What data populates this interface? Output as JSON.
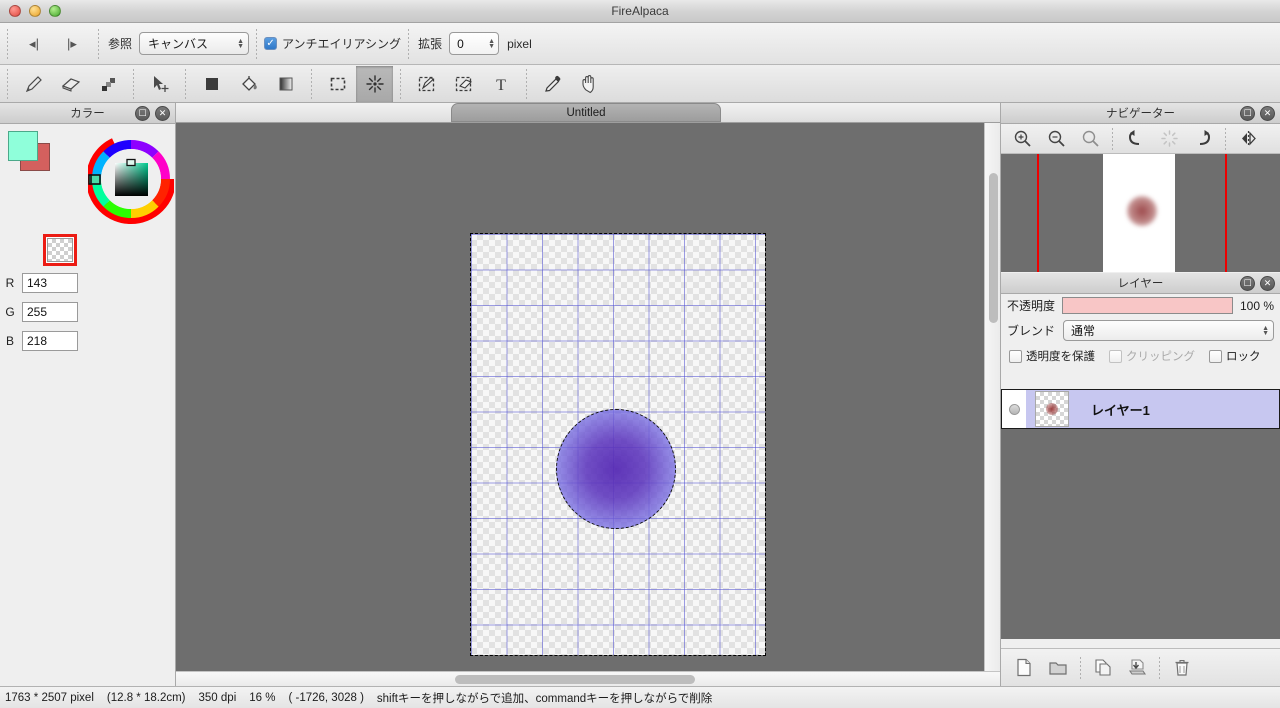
{
  "window": {
    "title": "FireAlpaca",
    "controls": [
      "close",
      "minimize",
      "zoom"
    ]
  },
  "option_bar": {
    "prev_label": "◂|",
    "next_label": "|▸",
    "reference_label": "参照",
    "reference_value": "キャンバス",
    "antialias_label": "アンチエイリアシング",
    "antialias_checked": true,
    "expand_label": "拡張",
    "expand_value": "0",
    "expand_unit": "pixel"
  },
  "tools": [
    {
      "name": "pencil-tool",
      "icon": "pencil",
      "active": false
    },
    {
      "name": "eraser-tool",
      "icon": "eraser",
      "active": false
    },
    {
      "name": "pixel-brush-tool",
      "icon": "pixel",
      "active": false
    },
    {
      "name": "move-tool",
      "icon": "move",
      "active": false
    },
    {
      "name": "fill-shape-tool",
      "icon": "square-fill",
      "active": false
    },
    {
      "name": "bucket-tool",
      "icon": "bucket",
      "active": false
    },
    {
      "name": "gradient-tool",
      "icon": "gradient",
      "active": false
    },
    {
      "name": "select-rect-tool",
      "icon": "marquee",
      "active": false
    },
    {
      "name": "magic-wand-tool",
      "icon": "wand",
      "active": true
    },
    {
      "name": "select-pen-tool",
      "icon": "select-pen",
      "active": false
    },
    {
      "name": "select-eraser-tool",
      "icon": "select-eraser",
      "active": false
    },
    {
      "name": "text-tool",
      "icon": "text-T",
      "active": false
    },
    {
      "name": "eyedropper-tool",
      "icon": "dropper",
      "active": false
    },
    {
      "name": "hand-tool",
      "icon": "hand",
      "active": false
    }
  ],
  "color_panel": {
    "title": "カラー",
    "foreground": "#8FFFDA",
    "background": "#D4605E",
    "transparent_selected": true,
    "selection_border": "#EC1C14",
    "channels": [
      {
        "label": "R",
        "value": "143"
      },
      {
        "label": "G",
        "value": "255"
      },
      {
        "label": "B",
        "value": "218"
      }
    ]
  },
  "canvas": {
    "tab_title": "Untitled",
    "grid_color": "#5050D2",
    "blob_color": "#5A2AB4",
    "selection": "marching-ants-ellipse"
  },
  "navigator": {
    "title": "ナビゲーター",
    "tools": [
      {
        "name": "zoom-in-icon",
        "label": "zoom-in"
      },
      {
        "name": "zoom-out-icon",
        "label": "zoom-out"
      },
      {
        "name": "zoom-reset-icon",
        "label": "zoom-reset"
      },
      {
        "name": "rotate-left-icon",
        "label": "rotate-left"
      },
      {
        "name": "rotate-reset-icon",
        "label": "rotate-reset"
      },
      {
        "name": "rotate-right-icon",
        "label": "rotate-right"
      },
      {
        "name": "flip-horizontal-icon",
        "label": "flip-horizontal"
      }
    ],
    "guide_color": "#EE0000"
  },
  "layer_panel": {
    "title": "レイヤー",
    "opacity_label": "不透明度",
    "opacity_value": "100 %",
    "opacity_fill": "#F8C6C6",
    "blend_label": "ブレンド",
    "blend_value": "通常",
    "checkboxes": [
      {
        "label": "透明度を保護",
        "checked": false,
        "disabled": false
      },
      {
        "label": "クリッピング",
        "checked": false,
        "disabled": true
      },
      {
        "label": "ロック",
        "checked": false,
        "disabled": false
      }
    ],
    "layers": [
      {
        "name": "レイヤー1",
        "visible": true,
        "selected": true
      }
    ],
    "toolbar": [
      {
        "name": "new-layer-button",
        "icon": "page"
      },
      {
        "name": "new-folder-button",
        "icon": "folder"
      },
      {
        "name": "duplicate-layer-button",
        "icon": "copy"
      },
      {
        "name": "merge-down-button",
        "icon": "merge"
      },
      {
        "name": "delete-layer-button",
        "icon": "trash"
      }
    ]
  },
  "status_bar": {
    "dimensions": "1763 * 2507 pixel",
    "physical": "(12.8 * 18.2cm)",
    "dpi": "350 dpi",
    "zoom": "16 %",
    "cursor": "( -1726, 3028 )",
    "hint": "shiftキーを押しながらで追加、commandキーを押しながらで削除"
  }
}
